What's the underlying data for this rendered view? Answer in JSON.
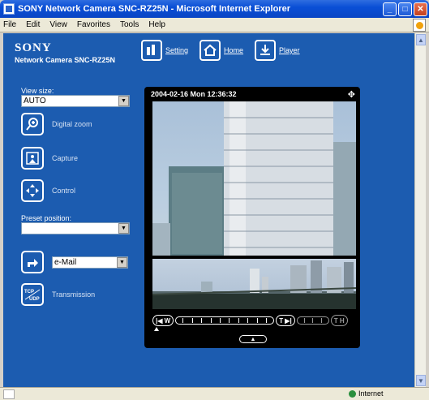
{
  "window": {
    "title": "SONY Network Camera SNC-RZ25N - Microsoft Internet Explorer"
  },
  "menu": [
    "File",
    "Edit",
    "View",
    "Favorites",
    "Tools",
    "Help"
  ],
  "header": {
    "brand": "SONY",
    "model": "Network Camera SNC-RZ25N",
    "nav": [
      {
        "label": "Setting",
        "icon": "setting-icon"
      },
      {
        "label": "Home",
        "icon": "home-icon"
      },
      {
        "label": "Player",
        "icon": "player-icon"
      }
    ]
  },
  "left": {
    "view_size_label": "View size:",
    "view_size_value": "AUTO",
    "digital_zoom": "Digital zoom",
    "capture": "Capture",
    "control": "Control",
    "preset_label": "Preset position:",
    "preset_value": "",
    "mail_value": "e-Mail",
    "transmission": "Transmission"
  },
  "viewer": {
    "timestamp": "2004-02-16 Mon 12:36:32",
    "zoom_wide": "W",
    "zoom_tele": "T",
    "zoom_tele_end": "T"
  },
  "status": {
    "zone": "Internet"
  },
  "colors": {
    "page_bg": "#1c5cb0",
    "titlebar": "#0a4fd6"
  }
}
